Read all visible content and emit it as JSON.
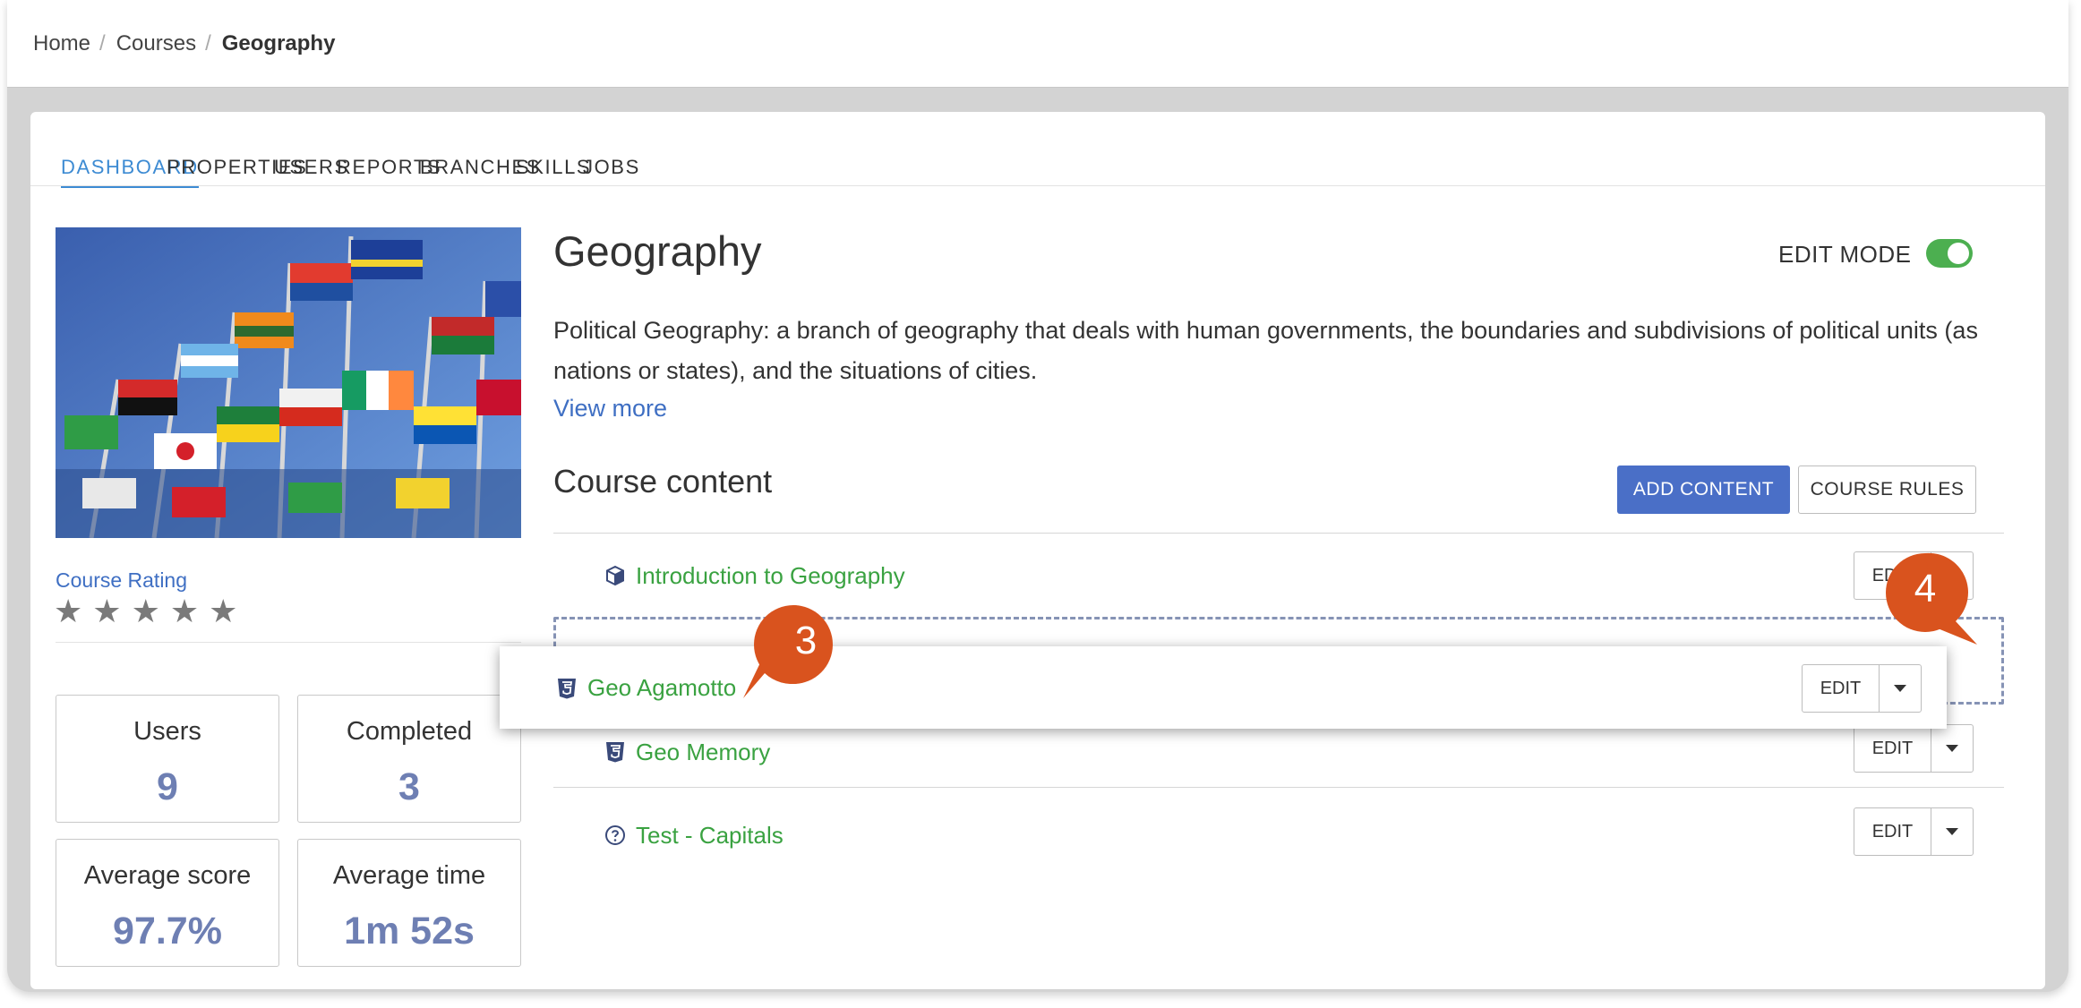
{
  "breadcrumb": {
    "home": "Home",
    "courses": "Courses",
    "current": "Geography",
    "separator": "/"
  },
  "tabs": [
    "DASHBOARD",
    "PROPERTIES",
    "USERS",
    "REPORTS",
    "BRANCHES",
    "SKILLS",
    "JOBS"
  ],
  "active_tab": "DASHBOARD",
  "course": {
    "title": "Geography",
    "description": "Political Geography: a branch of geography that deals with human governments, the boundaries and subdivisions of political units (as nations or states), and the situations of cities.",
    "view_more": "View more",
    "rating_label": "Course Rating",
    "rating": 0,
    "stars": [
      "★",
      "★",
      "★",
      "★",
      "★"
    ]
  },
  "edit_mode": {
    "label": "EDIT MODE",
    "on": true
  },
  "stats": {
    "users": {
      "label": "Users",
      "value": "9"
    },
    "completed": {
      "label": "Completed",
      "value": "3"
    },
    "avg_score": {
      "label": "Average score",
      "value": "97.7%"
    },
    "avg_time": {
      "label": "Average time",
      "value": "1m 52s"
    }
  },
  "course_content": {
    "title": "Course content",
    "add_content": "ADD CONTENT",
    "course_rules": "COURSE RULES",
    "edit_label": "EDIT",
    "items": [
      {
        "name": "Introduction to Geography",
        "icon": "scorm-box-icon"
      },
      {
        "name": "Geo Memory",
        "icon": "html5-icon"
      },
      {
        "name": "Test - Capitals",
        "icon": "question-circle-icon"
      }
    ],
    "dragging_item": {
      "name": "Geo Agamotto",
      "icon": "html5-icon"
    }
  },
  "callouts": [
    "3",
    "4"
  ],
  "colors": {
    "accent": "#3d8bd3",
    "primary_button": "#4a6fc7",
    "link_green": "#3aa241",
    "toggle_on": "#4caf50",
    "stat_value": "#6e7fb3",
    "callout": "#d9531e"
  }
}
